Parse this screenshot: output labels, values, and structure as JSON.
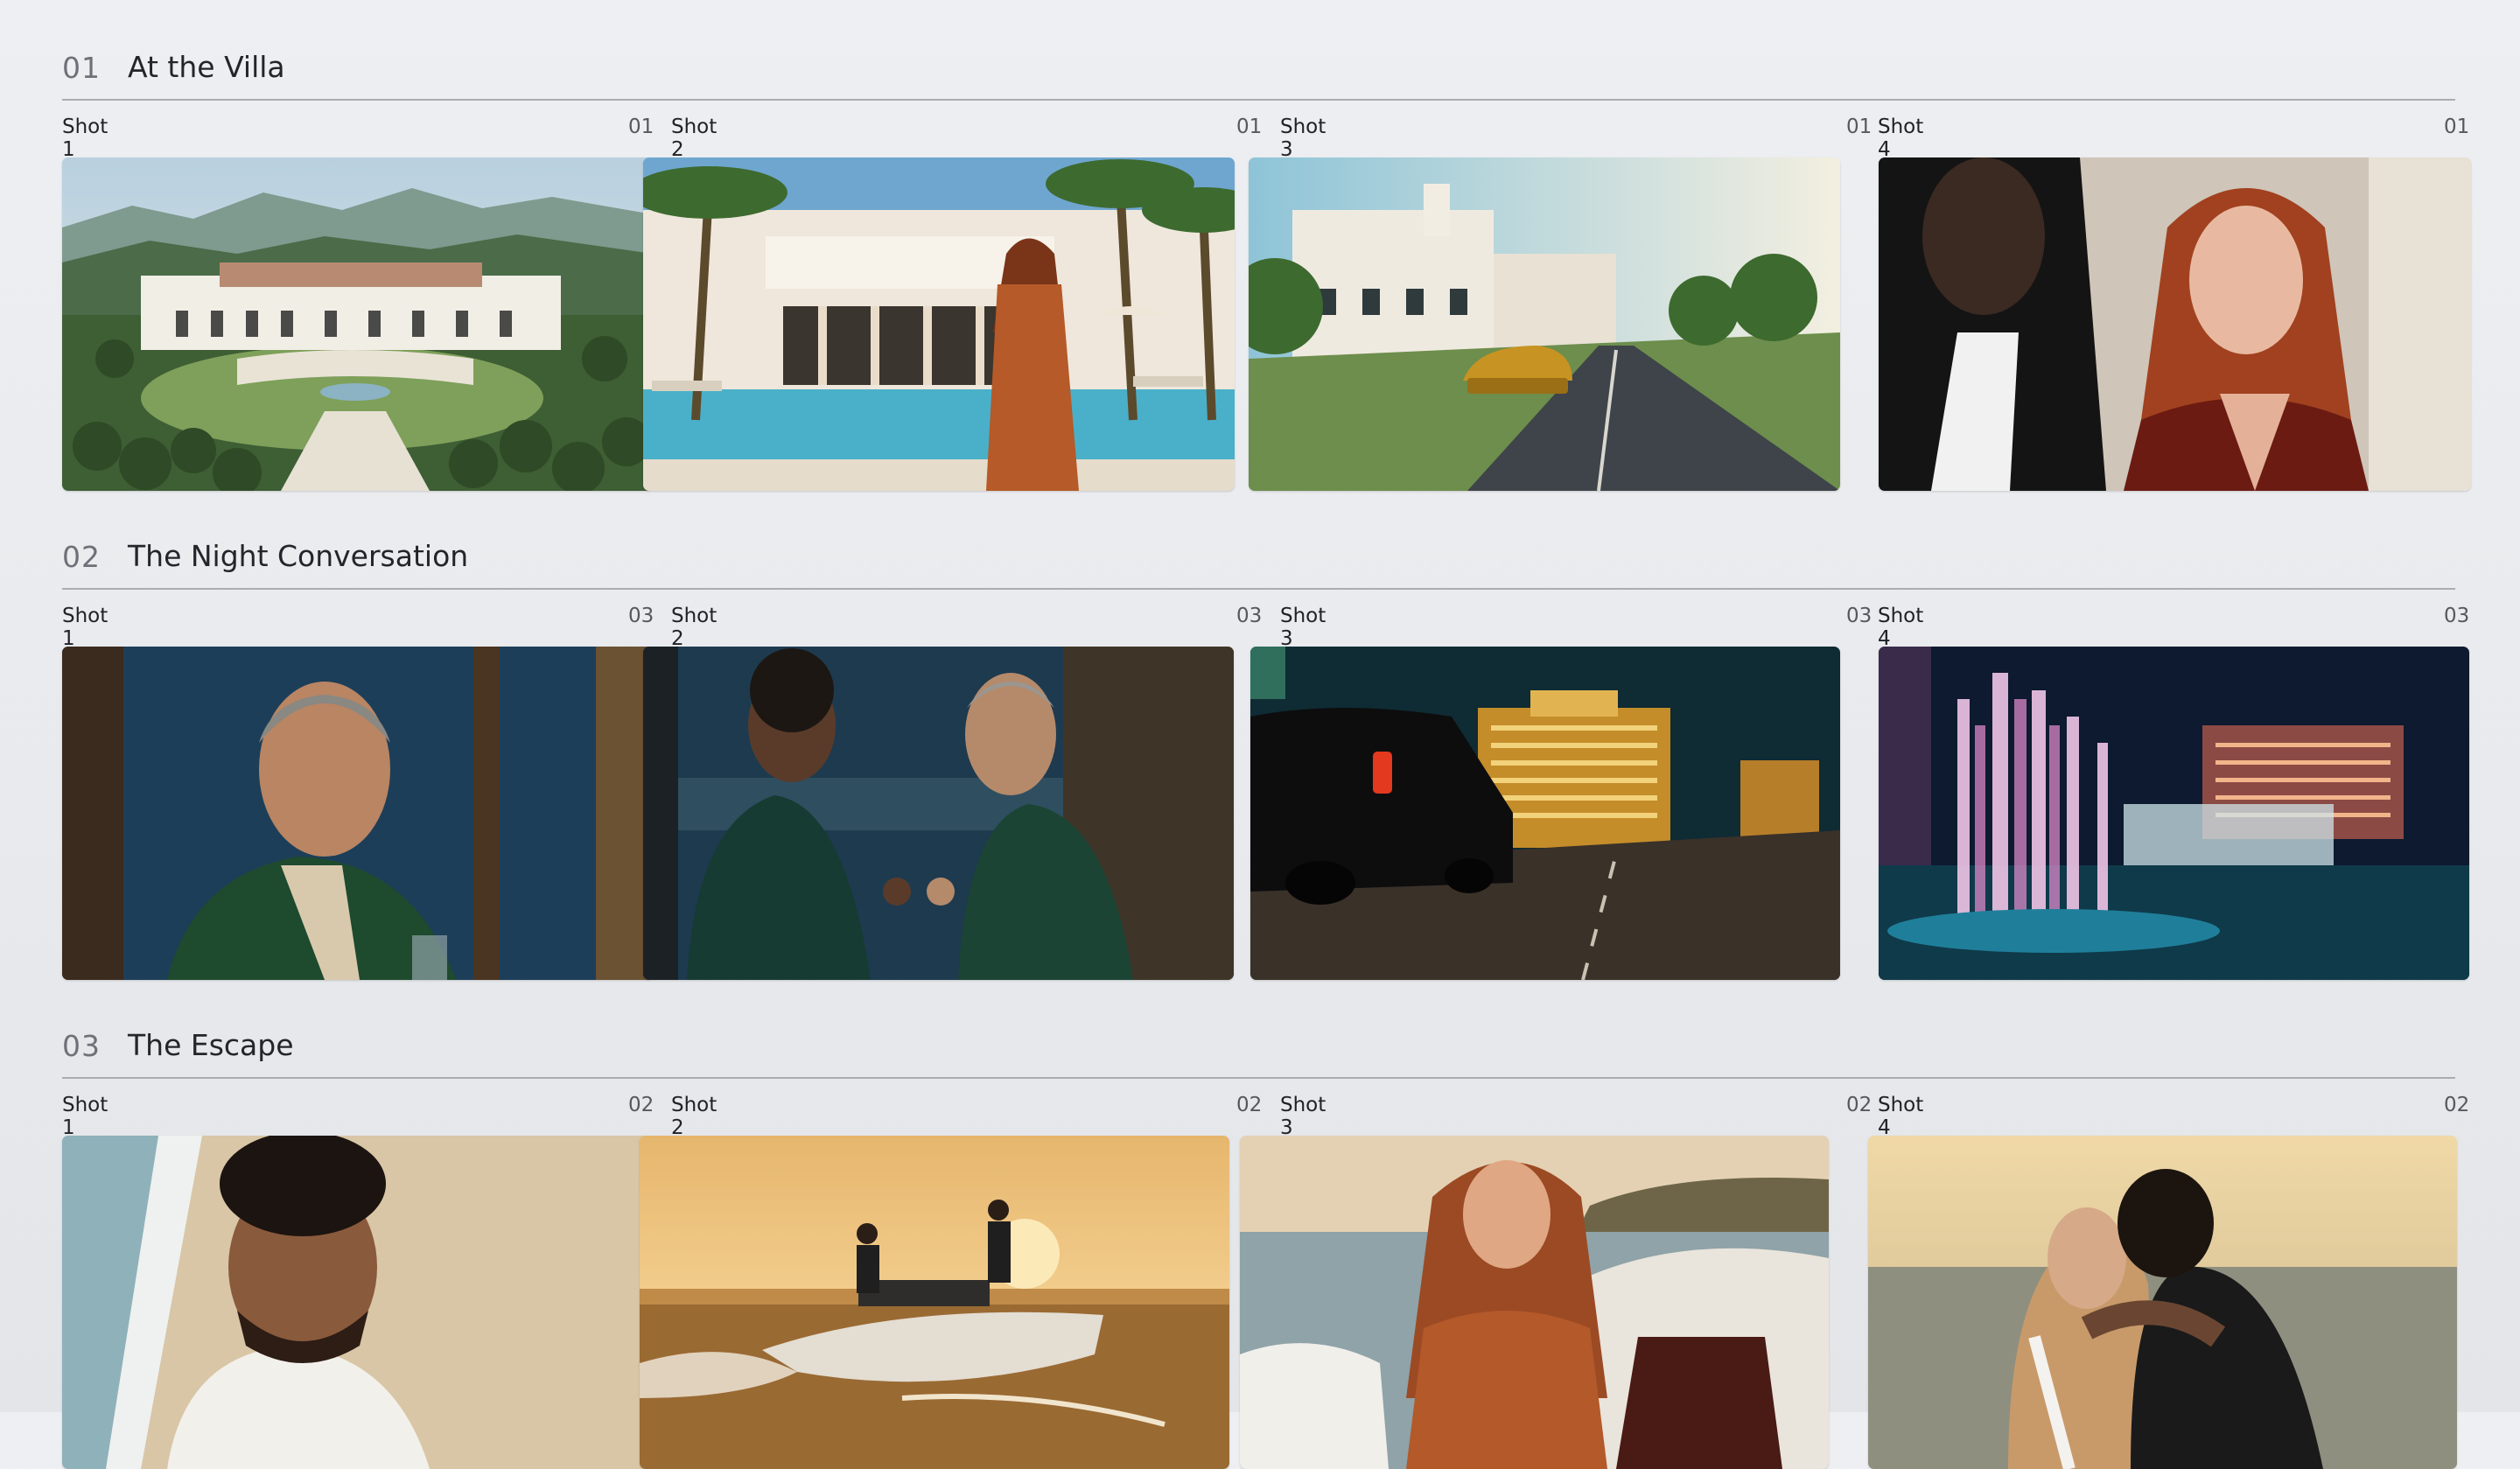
{
  "scenes": [
    {
      "number": "01",
      "title": "At the Villa",
      "shots": [
        {
          "label": "Shot 1",
          "take": "01"
        },
        {
          "label": "Shot 2",
          "take": "01"
        },
        {
          "label": "Shot 3",
          "take": "01"
        },
        {
          "label": "Shot 4",
          "take": "01"
        }
      ]
    },
    {
      "number": "02",
      "title": "The Night Conversation",
      "shots": [
        {
          "label": "Shot 1",
          "take": "03"
        },
        {
          "label": "Shot 2",
          "take": "03"
        },
        {
          "label": "Shot 3",
          "take": "03"
        },
        {
          "label": "Shot 4",
          "take": "03"
        }
      ]
    },
    {
      "number": "03",
      "title": "The Escape",
      "shots": [
        {
          "label": "Shot 1",
          "take": "02"
        },
        {
          "label": "Shot 2",
          "take": "02"
        },
        {
          "label": "Shot 3",
          "take": "02"
        },
        {
          "label": "Shot 4",
          "take": "02"
        }
      ]
    }
  ]
}
